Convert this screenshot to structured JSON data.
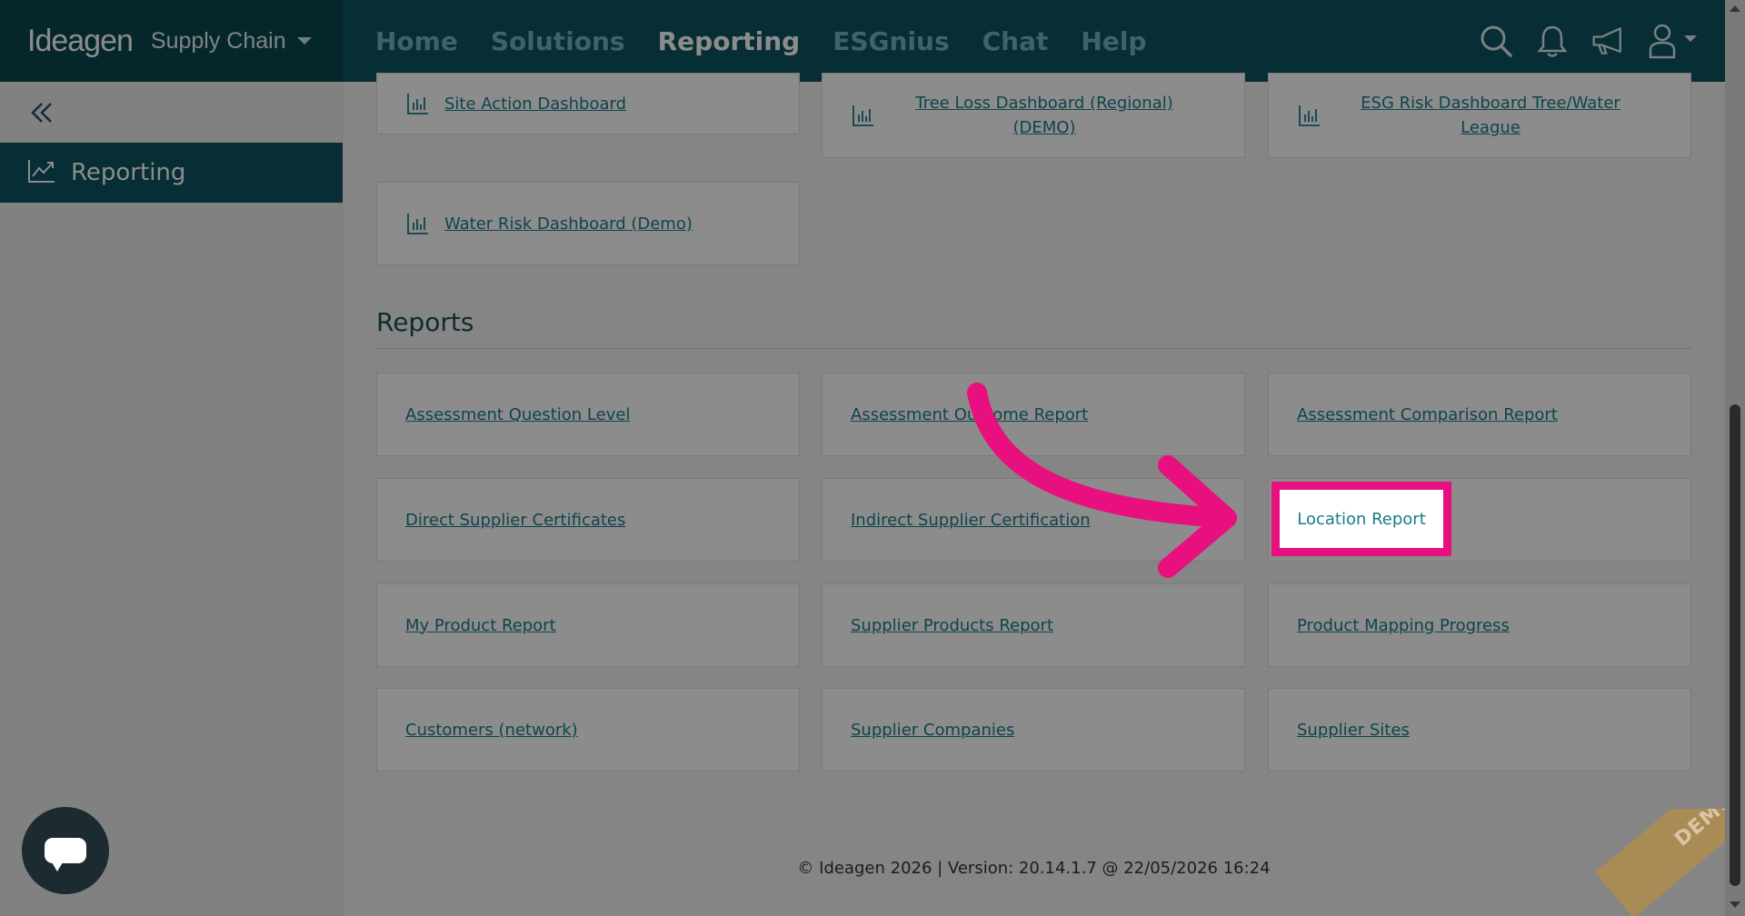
{
  "header": {
    "brand_logo": "Ideagen",
    "brand_product": "Supply Chain",
    "nav": [
      {
        "label": "Home",
        "active": false
      },
      {
        "label": "Solutions",
        "active": false
      },
      {
        "label": "Reporting",
        "active": true
      },
      {
        "label": "ESGnius",
        "active": false
      },
      {
        "label": "Chat",
        "active": false
      },
      {
        "label": "Help",
        "active": false
      }
    ],
    "icons": [
      "search-icon",
      "bell-icon",
      "megaphone-icon",
      "user-icon"
    ]
  },
  "sidebar": {
    "collapse_icon": "double-chevron-left-icon",
    "items": [
      {
        "label": "Reporting",
        "icon": "trend-chart-icon",
        "active": true
      }
    ]
  },
  "dashboards": [
    {
      "label": "Site Action Dashboard"
    },
    {
      "label": "Tree Loss Dashboard (Regional) (DEMO)"
    },
    {
      "label": "ESG Risk Dashboard Tree/Water League"
    },
    {
      "label": "Water Risk Dashboard (Demo)"
    }
  ],
  "reports_section": {
    "title": "Reports",
    "items": [
      {
        "label": "Assessment Question Level"
      },
      {
        "label": "Assessment Outcome Report"
      },
      {
        "label": "Assessment Comparison Report"
      },
      {
        "label": "Direct Supplier Certificates"
      },
      {
        "label": "Indirect Supplier Certification"
      },
      {
        "label": "Location Report",
        "highlighted": true
      },
      {
        "label": "My Product Report"
      },
      {
        "label": "Supplier Products Report"
      },
      {
        "label": "Product Mapping Progress"
      },
      {
        "label": "Customers (network)"
      },
      {
        "label": "Supplier Companies"
      },
      {
        "label": "Supplier Sites"
      }
    ]
  },
  "footer": {
    "text": "© Ideagen 2026 | Version: 20.14.1.7 @ 22/05/2026 16:24"
  },
  "demo_ribbon": "DEMO",
  "colors": {
    "brand_teal": "#0c5560",
    "brand_dark": "#0a4751",
    "link": "#1a7c8a",
    "highlight": "#e8107f"
  }
}
